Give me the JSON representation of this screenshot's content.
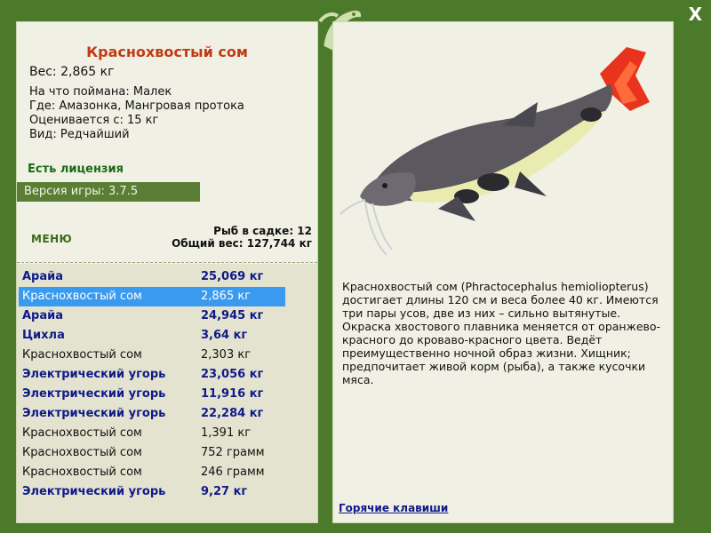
{
  "fish": {
    "name": "Краснохвостый сом",
    "weight": "Вес: 2,865 кг",
    "caught_with": "На что поймана: Малек",
    "location": "Где: Амазонка, Мангровая протока",
    "rated_from": "Оценивается с: 15 кг",
    "rarity": "Вид: Редчайший"
  },
  "license": "Есть лицензия",
  "version": "Версия игры: 3.7.5",
  "menu_label": "МЕНЮ",
  "keep": {
    "count": "Рыб в садке: 12",
    "total": "Общий вес: 127,744 кг"
  },
  "catch_list": [
    {
      "name": "Арайа",
      "value": "25,069 кг",
      "style": "bold"
    },
    {
      "name": "Краснохвостый сом",
      "value": "2,865 кг",
      "style": "selected"
    },
    {
      "name": "Арайа",
      "value": "24,945 кг",
      "style": "bold"
    },
    {
      "name": "Цихла",
      "value": "3,64 кг",
      "style": "bold"
    },
    {
      "name": "Краснохвостый сом",
      "value": "2,303 кг",
      "style": "plain"
    },
    {
      "name": "Электрический угорь",
      "value": "23,056 кг",
      "style": "bold"
    },
    {
      "name": "Электрический угорь",
      "value": "11,916 кг",
      "style": "bold"
    },
    {
      "name": "Электрический угорь",
      "value": "22,284 кг",
      "style": "bold"
    },
    {
      "name": "Краснохвостый сом",
      "value": "1,391 кг",
      "style": "plain"
    },
    {
      "name": "Краснохвостый сом",
      "value": "752 грамм",
      "style": "plain"
    },
    {
      "name": "Краснохвостый сом",
      "value": "246 грамм",
      "style": "plain"
    },
    {
      "name": "Электрический угорь",
      "value": "9,27 кг",
      "style": "bold"
    }
  ],
  "description": "Краснохвостый сом (Phractocephalus hemioliopterus) достигает длины 120 см и веса более 40 кг. Имеются три пары усов, две из них – сильно вытянутые. Окраска хвостового плавника меняется от оранжево-красного до кроваво-красного цвета. Ведёт преимущественно ночной образ жизни. Хищник; предпочитает живой корм (рыба), а также кусочки мяса.",
  "hotkeys_label": "Горячие клавиши",
  "close_label": "X",
  "colors": {
    "title": "#c23a14",
    "license": "#1a6a16",
    "bold_row": "#0f1a8a",
    "selected_row": "#3a9af0",
    "frame": "#4a7a2a"
  }
}
